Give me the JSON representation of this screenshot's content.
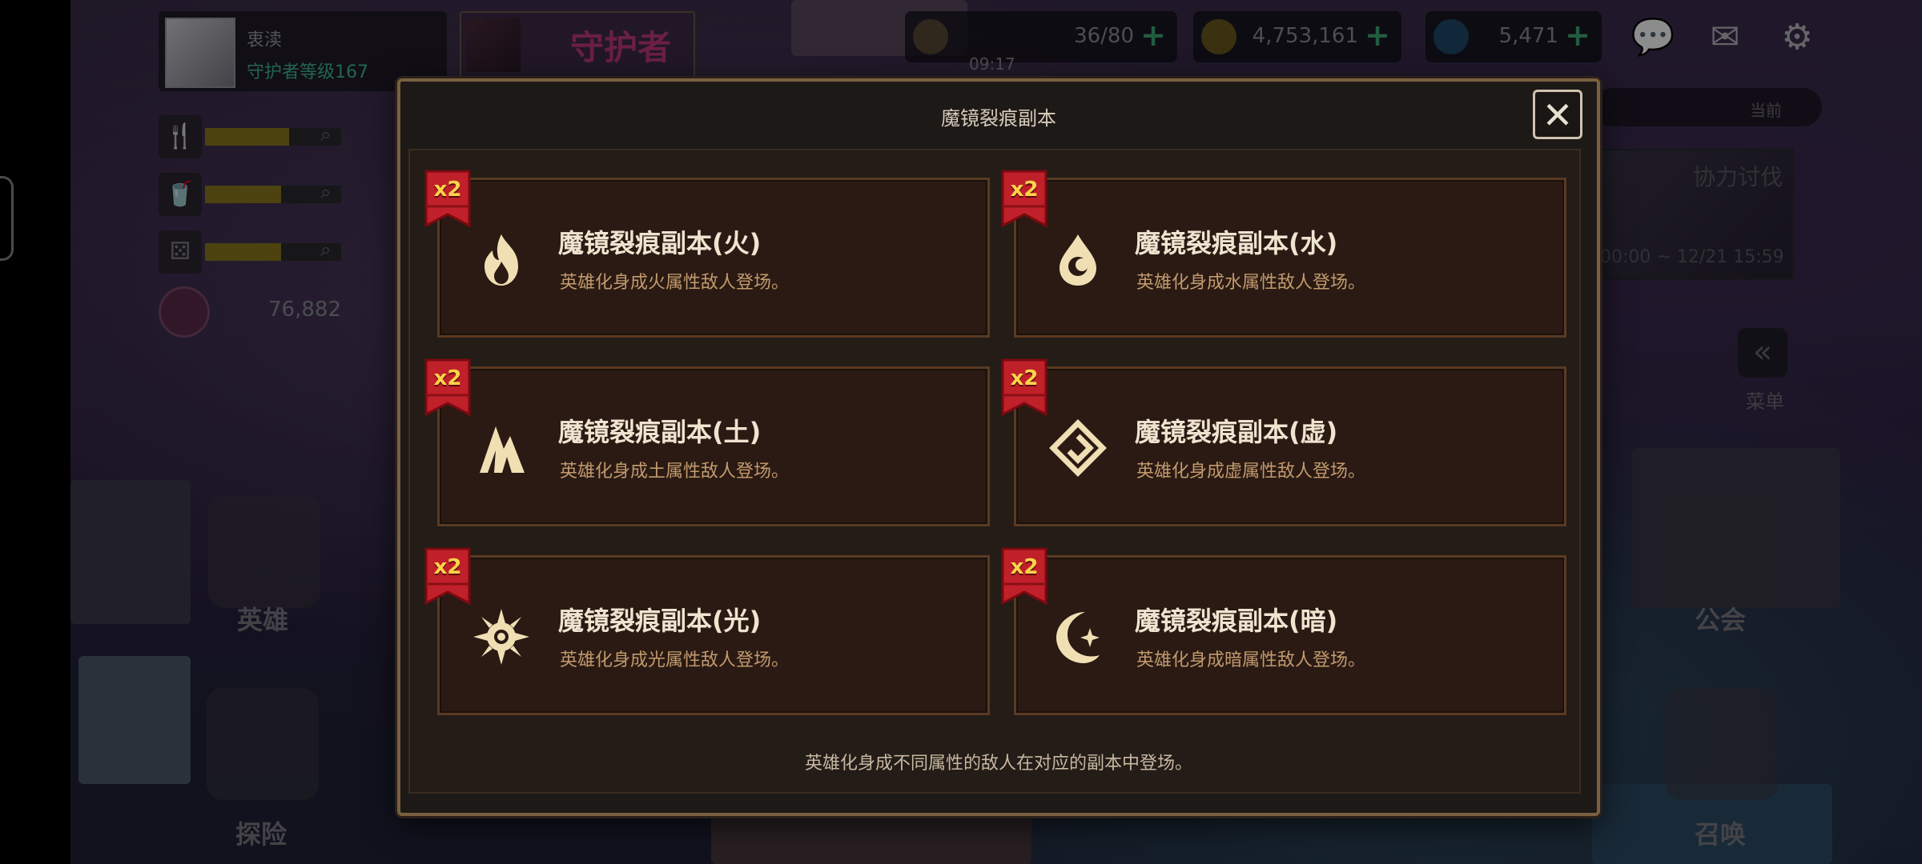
{
  "hud": {
    "player_name": "衷渎",
    "player_level": "守护者等级167",
    "guardian_label": "守护者",
    "stamina": "36/80",
    "stamina_timer": "09:17",
    "gold": "4,753,161",
    "gems": "5,471",
    "hearts": "76,882",
    "current_label": "当前"
  },
  "event": {
    "title": "协力讨伐",
    "dates": "00:00 ~ 12/21 15:59"
  },
  "side_menu": {
    "menu_label": "菜单",
    "hero_label": "英雄",
    "explore_label": "探险",
    "guild_label": "公会",
    "summon_label": "召唤"
  },
  "modal": {
    "title": "魔镜裂痕副本",
    "close_symbol": "✕",
    "footer": "英雄化身成不同属性的敌人在对应的副本中登场。",
    "multiplier_badge": "x2",
    "dungeons": [
      {
        "title": "魔镜裂痕副本(火)",
        "desc": "英雄化身成火属性敌人登场。",
        "icon": "fire-icon"
      },
      {
        "title": "魔镜裂痕副本(水)",
        "desc": "英雄化身成水属性敌人登场。",
        "icon": "water-drop-icon"
      },
      {
        "title": "魔镜裂痕副本(土)",
        "desc": "英雄化身成土属性敌人登场。",
        "icon": "mountain-icon"
      },
      {
        "title": "魔镜裂痕副本(虚)",
        "desc": "英雄化身成虚属性敌人登场。",
        "icon": "void-diamond-icon"
      },
      {
        "title": "魔镜裂痕副本(光)",
        "desc": "英雄化身成光属性敌人登场。",
        "icon": "sun-icon"
      },
      {
        "title": "魔镜裂痕副本(暗)",
        "desc": "英雄化身成暗属性敌人登场。",
        "icon": "crescent-moon-icon"
      }
    ]
  },
  "colors": {
    "card_title": "#efe4d0",
    "card_desc": "#c29a6e",
    "icon": "#f1dfb4",
    "ribbon_red": "#c0202a",
    "badge_text": "#ffd34a"
  }
}
